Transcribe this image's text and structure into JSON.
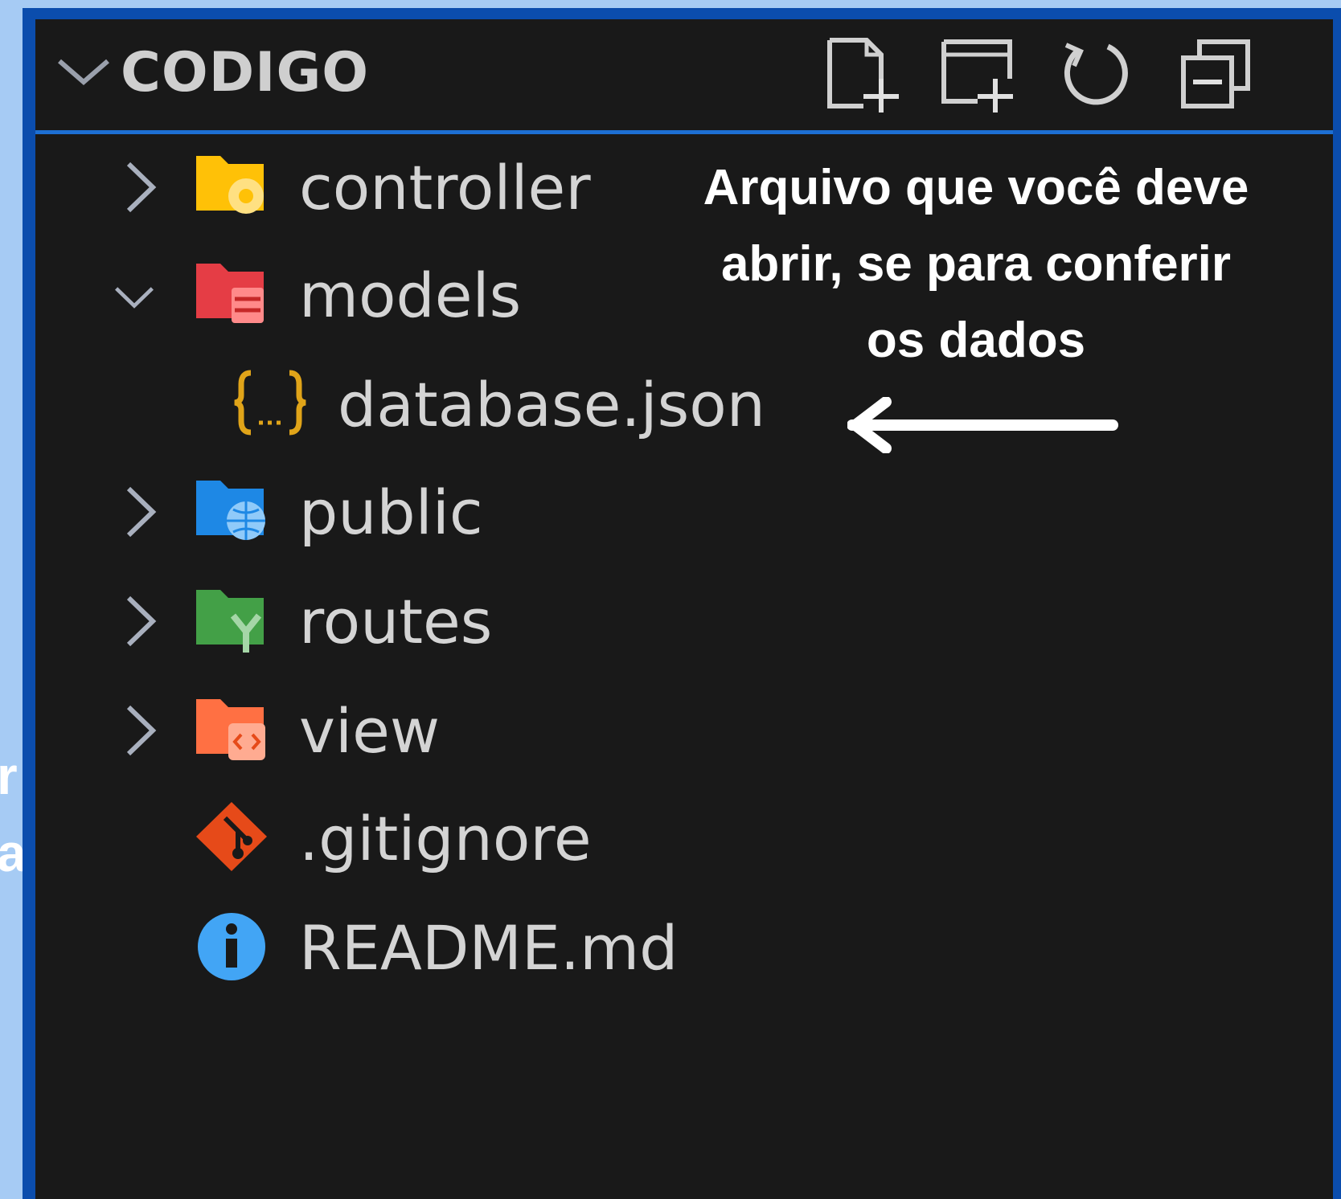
{
  "background_fragments": {
    "line1": "r",
    "line2": "a"
  },
  "explorer": {
    "section_title": "CODIGO",
    "header_actions": [
      {
        "icon": "new-file-icon"
      },
      {
        "icon": "new-folder-icon"
      },
      {
        "icon": "refresh-icon"
      },
      {
        "icon": "collapse-all-icon"
      }
    ],
    "items": [
      {
        "label": "controller",
        "type": "folder",
        "expanded": false,
        "icon_color": "#ffc107"
      },
      {
        "label": "models",
        "type": "folder",
        "expanded": true,
        "icon_color": "#e53d45"
      },
      {
        "label": "database.json",
        "type": "file",
        "icon": "json-icon",
        "icon_color": "#e0a419"
      },
      {
        "label": "public",
        "type": "folder",
        "expanded": false,
        "icon_color": "#1e88e5"
      },
      {
        "label": "routes",
        "type": "folder",
        "expanded": false,
        "icon_color": "#43a047"
      },
      {
        "label": "view",
        "type": "folder",
        "expanded": false,
        "icon_color": "#ff7043"
      },
      {
        "label": ".gitignore",
        "type": "file",
        "icon": "git-icon",
        "icon_color": "#e64a19"
      },
      {
        "label": "README.md",
        "type": "file",
        "icon": "info-icon",
        "icon_color": "#42a5f5"
      }
    ]
  },
  "annotation": {
    "lines": [
      "Arquivo que você deve",
      "abrir, se para conferir",
      "os dados"
    ]
  }
}
